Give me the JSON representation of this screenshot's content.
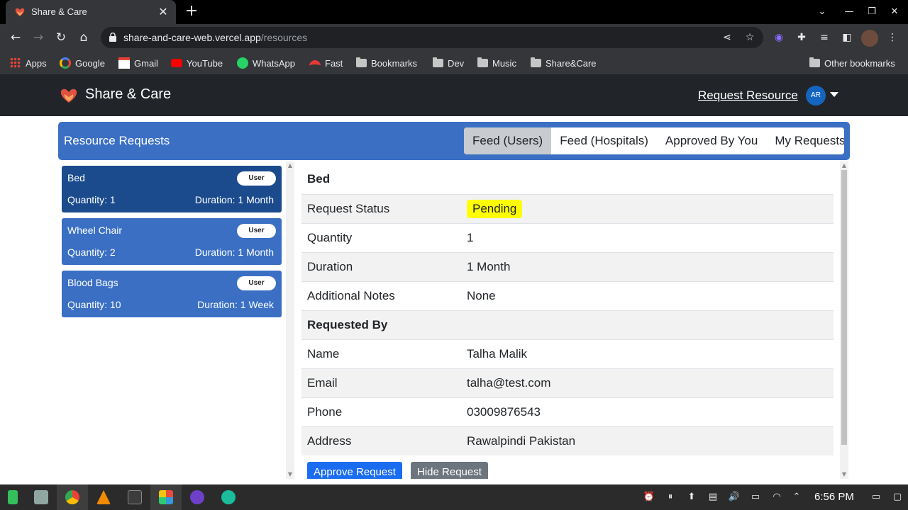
{
  "browser": {
    "tab_title": "Share & Care",
    "tab_close": "✕",
    "new_tab": "+",
    "url_host": "share-and-care-web.vercel.app",
    "url_path": "/resources",
    "bookmarks": [
      "Apps",
      "Google",
      "Gmail",
      "YouTube",
      "WhatsApp",
      "Fast",
      "Bookmarks",
      "Dev",
      "Music",
      "Share&Care"
    ],
    "other_bookmarks": "Other bookmarks"
  },
  "header": {
    "brand": "Share & Care",
    "request_resource": "Request Resource",
    "avatar_initials": "AR"
  },
  "requests_bar": {
    "title": "Resource Requests",
    "tabs": [
      "Feed (Users)",
      "Feed (Hospitals)",
      "Approved By You",
      "My Requests"
    ],
    "active_tab": "Feed (Users)"
  },
  "list": [
    {
      "title": "Bed",
      "badge": "User",
      "quantity": "Quantity: 1",
      "duration": "Duration: 1 Month",
      "selected": true
    },
    {
      "title": "Wheel Chair",
      "badge": "User",
      "quantity": "Quantity: 2",
      "duration": "Duration: 1 Month",
      "selected": false
    },
    {
      "title": "Blood Bags",
      "badge": "User",
      "quantity": "Quantity: 10",
      "duration": "Duration: 1 Week",
      "selected": false
    }
  ],
  "details": {
    "title": "Bed",
    "status_label": "Request Status",
    "status_value": "Pending",
    "quantity_label": "Quantity",
    "quantity_value": "1",
    "duration_label": "Duration",
    "duration_value": "1 Month",
    "notes_label": "Additional Notes",
    "notes_value": "None",
    "requested_by": "Requested By",
    "name_label": "Name",
    "name_value": "Talha Malik",
    "email_label": "Email",
    "email_value": "talha@test.com",
    "phone_label": "Phone",
    "phone_value": "03009876543",
    "address_label": "Address",
    "address_value": "Rawalpindi Pakistan",
    "approve_button": "Approve Request",
    "hide_button": "Hide Request"
  },
  "taskbar": {
    "clock": "6:56 PM"
  },
  "colors": {
    "brand_blue": "#3a6fc4",
    "selected_card": "#1c4b8d",
    "pending_yellow": "#ffff00",
    "approve_blue": "#1a6cf0",
    "hide_grey": "#6c757d"
  }
}
